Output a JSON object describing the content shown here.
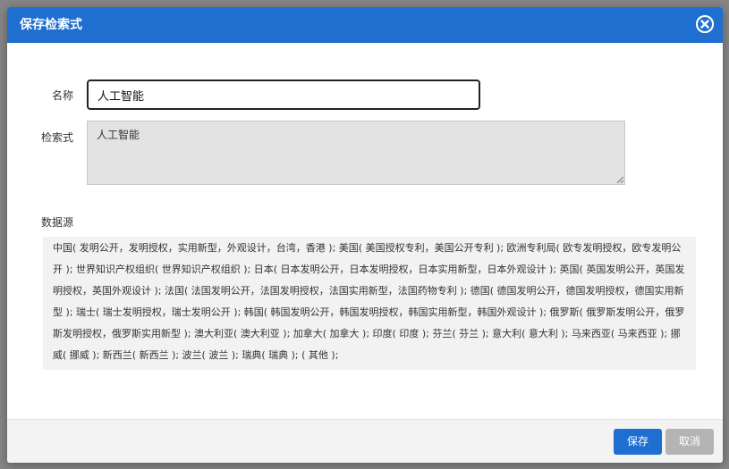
{
  "dialog": {
    "title": "保存检索式",
    "name_label": "名称",
    "name_value": "人工智能",
    "query_label": "检索式",
    "query_value": "人工智能",
    "sources_label": "数据源",
    "sources_text": "中国( 发明公开，发明授权，实用新型，外观设计，台湾，香港 ); 美国( 美国授权专利，美国公开专利 ); 欧洲专利局( 欧专发明授权，欧专发明公开 ); 世界知识产权组织( 世界知识产权组织 ); 日本( 日本发明公开，日本发明授权，日本实用新型，日本外观设计 ); 英国( 英国发明公开，英国发明授权，英国外观设计 ); 法国( 法国发明公开，法国发明授权，法国实用新型，法国药物专利 ); 德国( 德国发明公开，德国发明授权，德国实用新型 ); 瑞士( 瑞士发明授权，瑞士发明公开 ); 韩国( 韩国发明公开，韩国发明授权，韩国实用新型，韩国外观设计 ); 俄罗斯( 俄罗斯发明公开，俄罗斯发明授权，俄罗斯实用新型 ); 澳大利亚( 澳大利亚 ); 加拿大( 加拿大 ); 印度( 印度 ); 芬兰( 芬兰 ); 意大利( 意大利 ); 马来西亚( 马来西亚 ); 挪威( 挪威 ); 新西兰( 新西兰 ); 波兰( 波兰 ); 瑞典( 瑞典 ); ( 其他 );",
    "save_label": "保存",
    "cancel_label": "取消"
  },
  "colors": {
    "header": "#1e6fcf",
    "save_button": "#1e6fcf",
    "cancel_button": "#b4b4b4"
  },
  "icons": {
    "close": "close-circle-icon"
  }
}
